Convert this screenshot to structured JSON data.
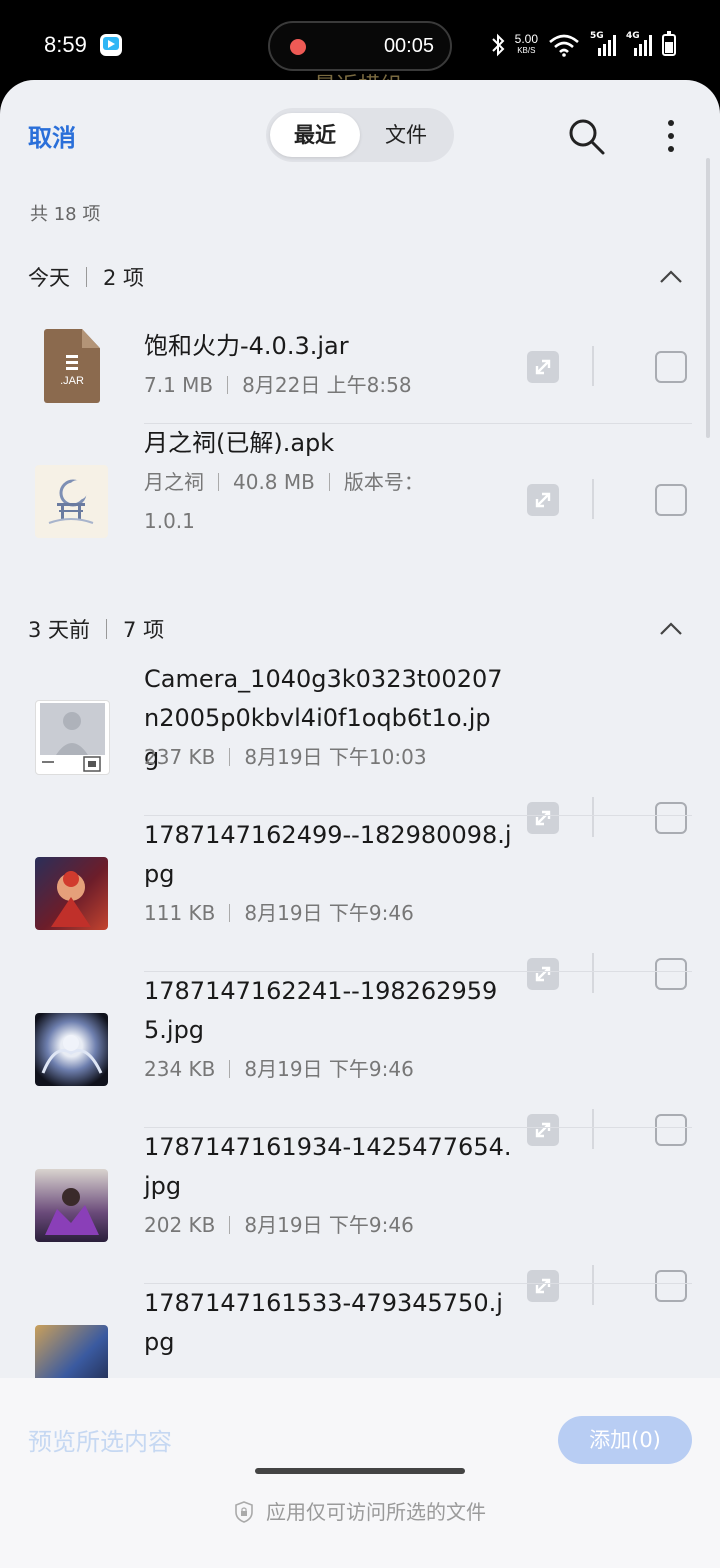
{
  "status_bar": {
    "time": "8:59",
    "recording_time": "00:05",
    "net_speed": "5.00",
    "net_unit": "KB/S",
    "sig1": "5G",
    "sig2": "4G",
    "icons": [
      "video-app-icon",
      "record-dot-icon",
      "bluetooth-icon",
      "wifi-icon",
      "signal-5g-icon",
      "signal-4g-icon",
      "battery-icon"
    ]
  },
  "peek_text": "最近横组",
  "header": {
    "cancel": "取消",
    "tabs": [
      {
        "label": "最近",
        "active": true
      },
      {
        "label": "文件",
        "active": false
      }
    ]
  },
  "summary": "共 18 项",
  "groups": [
    {
      "title": "今天",
      "count": "2 项",
      "items": [
        {
          "name": "饱和火力-4.0.3.jar",
          "meta": [
            "7.1 MB",
            "8月22日 上午8:58"
          ],
          "icon": "jar-file-icon",
          "ext": ".JAR"
        },
        {
          "name": "月之祠(已解).apk",
          "meta": [
            "月之祠",
            "40.8 MB",
            "版本号：1.0.1"
          ],
          "icon": "app-thumbnail"
        }
      ]
    },
    {
      "title": "3 天前",
      "count": "7 项",
      "items": [
        {
          "name": "Camera_1040g3k0323t00207n2005p0kbvl4i0f1oqb6t1o.jpg",
          "meta": [
            "237 KB",
            "8月19日 下午10:03"
          ],
          "icon": "image-thumbnail"
        },
        {
          "name": "1787147162499--182980098.jpg",
          "meta": [
            "111 KB",
            "8月19日 下午9:46"
          ],
          "icon": "image-thumbnail"
        },
        {
          "name": "1787147162241--1982629595.jpg",
          "meta": [
            "234 KB",
            "8月19日 下午9:46"
          ],
          "icon": "image-thumbnail"
        },
        {
          "name": "1787147161934-1425477654.jpg",
          "meta": [
            "202 KB",
            "8月19日 下午9:46"
          ],
          "icon": "image-thumbnail"
        },
        {
          "name": "1787147161533-479345750.jpg",
          "meta": [],
          "icon": "image-thumbnail"
        }
      ]
    }
  ],
  "footer": {
    "preview": "预览所选内容",
    "add": "添加(0)",
    "privacy": "应用仅可访问所选的文件"
  },
  "colors": {
    "accent": "#2a6fd9",
    "sheet_bg": "#eef0f4",
    "add_disabled": "#b8cdf3"
  }
}
